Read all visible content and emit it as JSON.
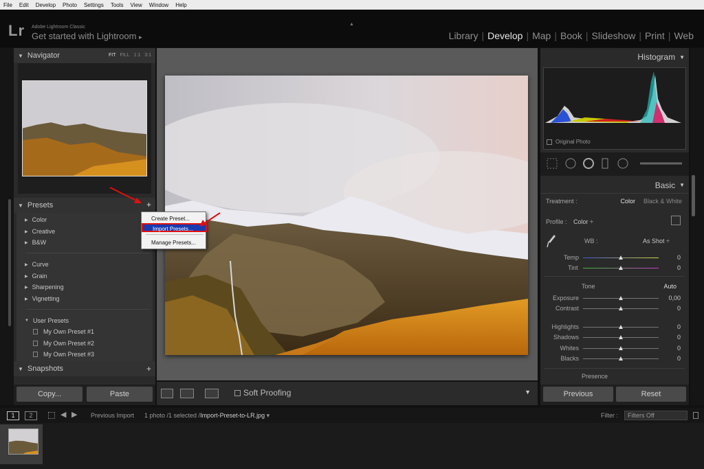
{
  "menubar": [
    "File",
    "Edit",
    "Develop",
    "Photo",
    "Settings",
    "Tools",
    "View",
    "Window",
    "Help"
  ],
  "identity": {
    "logo": "Lr",
    "app_name": "Adobe Lightroom Classic",
    "get_started": "Get started with Lightroom",
    "get_started_arrow": "▸"
  },
  "modules": [
    {
      "label": "Library",
      "active": false
    },
    {
      "label": "Develop",
      "active": true
    },
    {
      "label": "Map",
      "active": false
    },
    {
      "label": "Book",
      "active": false
    },
    {
      "label": "Slideshow",
      "active": false
    },
    {
      "label": "Print",
      "active": false
    },
    {
      "label": "Web",
      "active": false
    }
  ],
  "navigator": {
    "title": "Navigator",
    "options": [
      "FIT",
      "FILL",
      "1:1",
      "3:1"
    ],
    "active_option": "FIT"
  },
  "presets": {
    "title": "Presets",
    "groups_a": [
      "Color",
      "Creative",
      "B&W"
    ],
    "groups_b": [
      "Curve",
      "Grain",
      "Sharpening",
      "Vignetting"
    ],
    "user_group": "User Presets",
    "user_items": [
      "My Own Preset #1",
      "My Own Preset #2",
      "My Own Preset #3"
    ]
  },
  "snapshots": {
    "title": "Snapshots"
  },
  "left_buttons": {
    "copy": "Copy...",
    "paste": "Paste"
  },
  "context_menu": {
    "create": "Create Preset...",
    "import": "Import Presets...",
    "manage": "Manage Presets..."
  },
  "toolbar": {
    "soft_proofing": "Soft Proofing"
  },
  "histogram": {
    "title": "Histogram",
    "original_photo": "Original Photo"
  },
  "basic": {
    "title": "Basic",
    "treatment_label": "Treatment :",
    "treatment_color": "Color",
    "treatment_bw": "Black & White",
    "profile_label": "Profile :",
    "profile_value": "Color ÷",
    "wb_label": "WB :",
    "wb_value": "As Shot ÷",
    "temp_label": "Temp",
    "temp_value": "0",
    "tint_label": "Tint",
    "tint_value": "0",
    "tone_label": "Tone",
    "auto_label": "Auto",
    "sliders": [
      {
        "label": "Exposure",
        "value": "0,00"
      },
      {
        "label": "Contrast",
        "value": "0"
      },
      {
        "label": "Highlights",
        "value": "0"
      },
      {
        "label": "Shadows",
        "value": "0"
      },
      {
        "label": "Whites",
        "value": "0"
      },
      {
        "label": "Blacks",
        "value": "0"
      }
    ],
    "presence_label": "Presence"
  },
  "right_buttons": {
    "previous": "Previous",
    "reset": "Reset"
  },
  "filmstrip_bar": {
    "screen1": "1",
    "screen2": "2",
    "source": "Previous Import",
    "info_count": "1 photo /1 selected /",
    "filename": "Import-Preset-to-LR.jpg",
    "filter_label": "Filter :",
    "filter_value": "Filters Off"
  },
  "colors": {
    "accent_red": "#e01010",
    "menu_highlight": "#1a3ab0",
    "sky": "#d8d2d4",
    "grass": "#d1861a"
  }
}
